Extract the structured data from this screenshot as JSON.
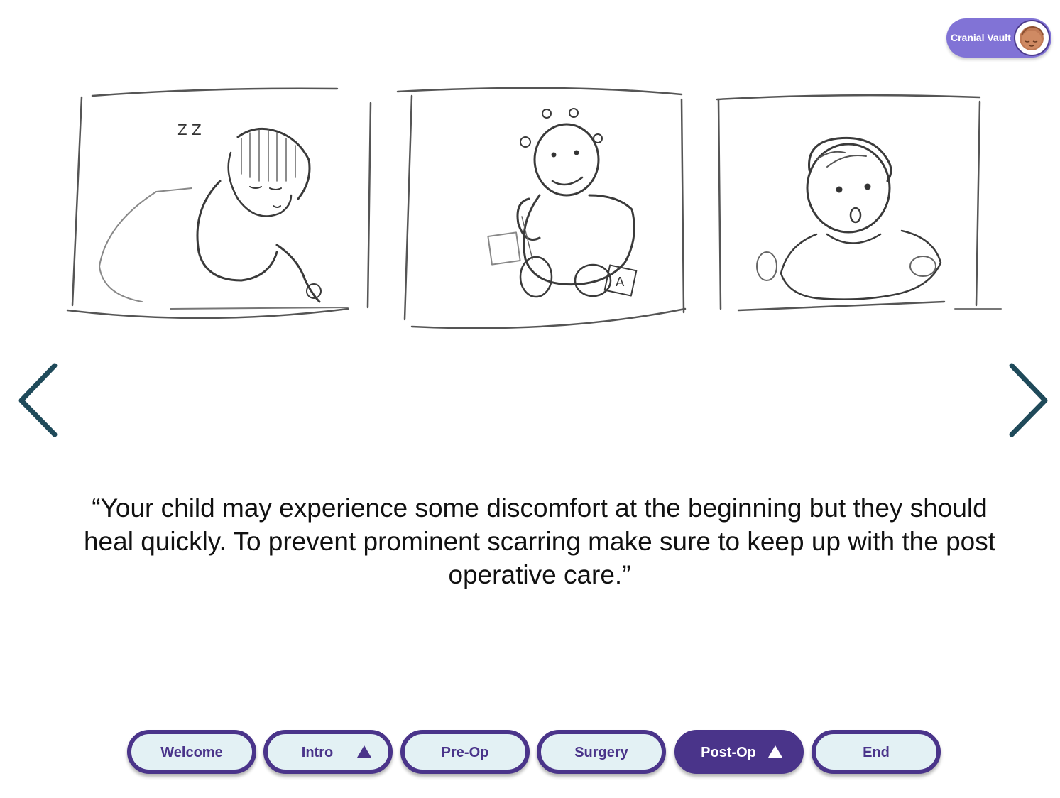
{
  "profile": {
    "label": "Cranial Vault",
    "avatar_icon": "baby-head-avatar"
  },
  "storyboard": {
    "panels": [
      {
        "name": "sleeping-child-sketch",
        "text": "Z Z"
      },
      {
        "name": "playing-child-sketch",
        "text": "A"
      },
      {
        "name": "surprised-child-sketch",
        "text": ""
      }
    ]
  },
  "navigation": {
    "prev_icon": "chevron-left-icon",
    "next_icon": "chevron-right-icon",
    "arrow_color": "#1f4a5a"
  },
  "caption": {
    "text": "“Your child may experience some discomfort at the beginning but they should heal quickly. To prevent prominent scarring make sure to keep up with the post operative care.”"
  },
  "tabs": [
    {
      "label": "Welcome",
      "active": false,
      "caret": false
    },
    {
      "label": "Intro",
      "active": false,
      "caret": true
    },
    {
      "label": "Pre-Op",
      "active": false,
      "caret": false
    },
    {
      "label": "Surgery",
      "active": false,
      "caret": false
    },
    {
      "label": "Post-Op",
      "active": true,
      "caret": true
    },
    {
      "label": "End",
      "active": false,
      "caret": false
    }
  ],
  "colors": {
    "accent": "#4a348a",
    "pill": "#8173d6",
    "tab_bg": "#e3f1f4"
  }
}
